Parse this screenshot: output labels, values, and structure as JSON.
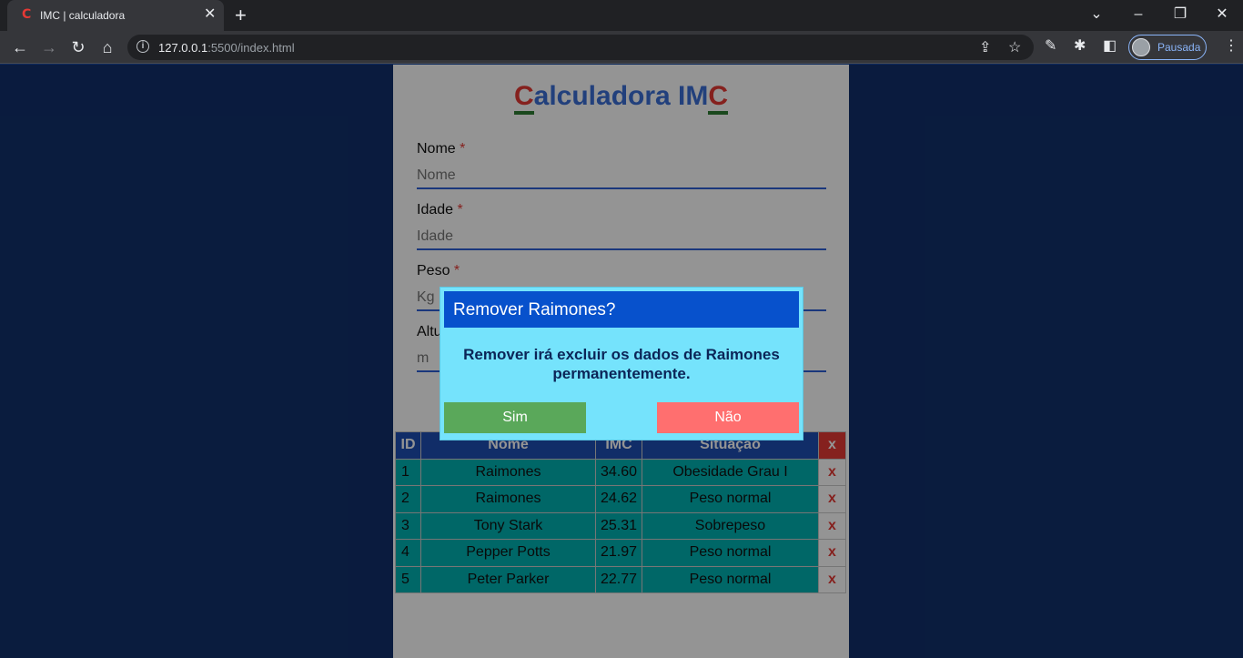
{
  "browser": {
    "tab_title": "IMC | calculadora",
    "tab_favicon": "C",
    "url_host": "127.0.0.1",
    "url_rest": ":5500/index.html",
    "profile_label": "Pausada"
  },
  "form": {
    "title_first": "C",
    "title_middle": "alculadora IM",
    "title_last": "C",
    "fields": [
      {
        "label": "Nome",
        "required": "*",
        "placeholder": "Nome"
      },
      {
        "label": "Idade",
        "required": "*",
        "placeholder": "Idade"
      },
      {
        "label": "Peso",
        "required": "*",
        "placeholder": "Kg"
      },
      {
        "label": "Altura",
        "required": "*",
        "placeholder": "m"
      }
    ]
  },
  "table": {
    "headers": {
      "id": "ID",
      "name": "Nome",
      "imc": "IMC",
      "status": "Situação",
      "delete": "x"
    },
    "rows": [
      {
        "id": "1",
        "name": "Raimones",
        "imc": "34.60",
        "status": "Obesidade Grau I",
        "delete": "x"
      },
      {
        "id": "2",
        "name": "Raimones",
        "imc": "24.62",
        "status": "Peso normal",
        "delete": "x"
      },
      {
        "id": "3",
        "name": "Tony Stark",
        "imc": "25.31",
        "status": "Sobrepeso",
        "delete": "x"
      },
      {
        "id": "4",
        "name": "Pepper Potts",
        "imc": "21.97",
        "status": "Peso normal",
        "delete": "x"
      },
      {
        "id": "5",
        "name": "Peter Parker",
        "imc": "22.77",
        "status": "Peso normal",
        "delete": "x"
      }
    ]
  },
  "modal": {
    "title": "Remover Raimones?",
    "message": "Remover irá excluir os dados de Raimones permanentemente.",
    "confirm_label": "Sim",
    "cancel_label": "Não"
  },
  "colors": {
    "page_bg": "#12306b",
    "modal_bg": "#75e3fc",
    "modal_header": "#0751cc",
    "confirm": "#5aa85a",
    "cancel": "#ff6f6f"
  }
}
